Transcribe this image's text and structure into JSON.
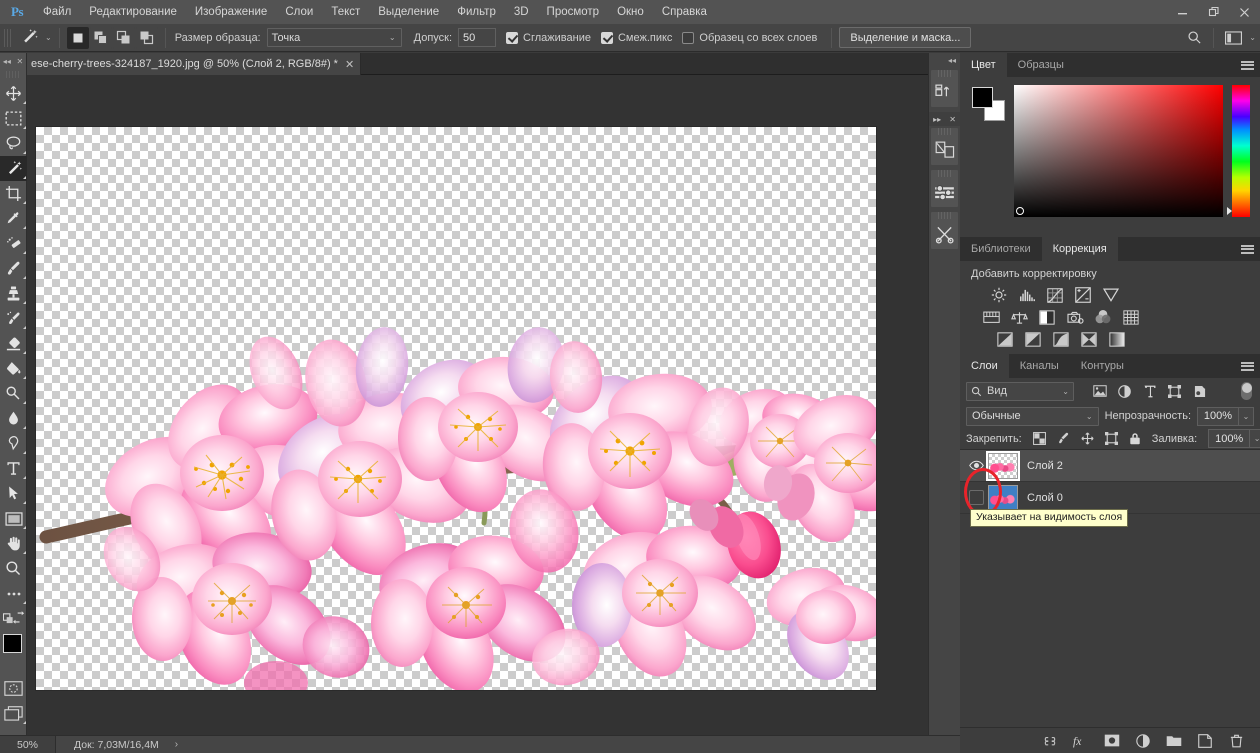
{
  "app": {
    "logo": "Ps",
    "menu": [
      "Файл",
      "Редактирование",
      "Изображение",
      "Слои",
      "Текст",
      "Выделение",
      "Фильтр",
      "3D",
      "Просмотр",
      "Окно",
      "Справка"
    ],
    "window_controls": {
      "minimize": "minimize-icon",
      "restore": "restore-icon",
      "close": "close-icon"
    }
  },
  "options_bar": {
    "tool_icon": "magic-wand-icon",
    "selection_modes": [
      "new-selection",
      "add-to-selection",
      "subtract-from-selection",
      "intersect-selection"
    ],
    "active_selection_mode": 0,
    "sample_size_label": "Размер образца:",
    "sample_size_value": "Точка",
    "tolerance_label": "Допуск:",
    "tolerance_value": "50",
    "antialias_label": "Сглаживание",
    "antialias_checked": true,
    "contiguous_label": "Смеж.пикс",
    "contiguous_checked": true,
    "all_layers_label": "Образец со всех слоев",
    "all_layers_checked": false,
    "select_and_mask_label": "Выделение и маска...",
    "search_icon": "search-icon",
    "workspace_icon": "workspace-switcher-icon"
  },
  "toolbar": {
    "tools": [
      {
        "name": "move-tool",
        "icon": "move-icon",
        "has_flyout": true
      },
      {
        "name": "rectangular-marquee-tool",
        "icon": "marquee-icon",
        "has_flyout": true
      },
      {
        "name": "lasso-tool",
        "icon": "lasso-icon",
        "has_flyout": true
      },
      {
        "name": "magic-wand-tool",
        "icon": "magic-wand-icon",
        "has_flyout": true,
        "active": true
      },
      {
        "name": "crop-tool",
        "icon": "crop-icon",
        "has_flyout": true
      },
      {
        "name": "eyedropper-tool",
        "icon": "eyedropper-icon",
        "has_flyout": true
      },
      {
        "name": "healing-brush-tool",
        "icon": "healing-brush-icon",
        "has_flyout": true
      },
      {
        "name": "brush-tool",
        "icon": "brush-icon",
        "has_flyout": true
      },
      {
        "name": "clone-stamp-tool",
        "icon": "clone-stamp-icon",
        "has_flyout": true
      },
      {
        "name": "history-brush-tool",
        "icon": "history-brush-icon",
        "has_flyout": true
      },
      {
        "name": "eraser-tool",
        "icon": "eraser-icon",
        "has_flyout": true
      },
      {
        "name": "paint-bucket-tool",
        "icon": "paint-bucket-icon",
        "has_flyout": true
      },
      {
        "name": "dodge-tool",
        "icon": "dodge-icon",
        "has_flyout": true
      },
      {
        "name": "blur-tool",
        "icon": "blur-drop-icon",
        "has_flyout": true
      },
      {
        "name": "pen-tool",
        "icon": "pen-icon",
        "has_flyout": true
      },
      {
        "name": "type-tool",
        "icon": "type-icon",
        "has_flyout": true
      },
      {
        "name": "path-selection-tool",
        "icon": "path-arrow-icon",
        "has_flyout": true
      },
      {
        "name": "rectangle-tool",
        "icon": "rectangle-shape-icon",
        "has_flyout": true
      },
      {
        "name": "hand-tool",
        "icon": "hand-icon",
        "has_flyout": true
      },
      {
        "name": "zoom-tool",
        "icon": "zoom-icon",
        "has_flyout": false
      },
      {
        "name": "edit-toolbar",
        "icon": "ellipsis-icon",
        "has_flyout": true
      }
    ],
    "foreground_color": "#000000",
    "background_color": "#ffffff",
    "quick_mask": "quick-mask-icon",
    "screen_mode": "screen-mode-icon"
  },
  "document": {
    "tab_title": "ese-cherry-trees-324187_1920.jpg @ 50% (Слой 2, RGB/8#) *",
    "close_glyph": "✕",
    "zoom": "50%",
    "doc_size": "Док: 7,03M/16,4M",
    "status_arrow": "›"
  },
  "dock_strip": {
    "icons": [
      "workspace-arrange-icon",
      "layer-comps-icon",
      "properties-sliders-icon",
      "tools-scissors-icon"
    ]
  },
  "color_panel": {
    "tabs": [
      {
        "label": "Цвет",
        "active": true
      },
      {
        "label": "Образцы",
        "active": false
      }
    ],
    "menu_icon": "panel-menu-icon",
    "foreground": "#000000",
    "background": "#ffffff",
    "field_base_color": "#fe0000"
  },
  "corrections_panel": {
    "tabs": [
      {
        "label": "Библиотеки",
        "active": false
      },
      {
        "label": "Коррекция",
        "active": true
      }
    ],
    "menu_icon": "panel-menu-icon",
    "title": "Добавить корректировку",
    "row1": [
      "brightness-contrast-icon",
      "levels-icon",
      "curves-icon",
      "exposure-icon",
      "vibrance-icon"
    ],
    "row2": [
      "hue-saturation-icon",
      "color-balance-icon",
      "black-white-icon",
      "photo-filter-icon",
      "channel-mixer-icon",
      "color-lookup-icon"
    ],
    "row3": [
      "invert-icon",
      "posterize-icon",
      "threshold-icon",
      "selective-color-icon",
      "gradient-map-icon"
    ]
  },
  "layers_panel": {
    "tabs": [
      {
        "label": "Слои",
        "active": true
      },
      {
        "label": "Каналы",
        "active": false
      },
      {
        "label": "Контуры",
        "active": false
      }
    ],
    "menu_icon": "panel-menu-icon",
    "filter_kind_value": "Вид",
    "filter_search_icon": "search-icon",
    "filter_icons": [
      "pixel-layers-filter-icon",
      "adjustment-layers-filter-icon",
      "type-layers-filter-icon",
      "shape-layers-filter-icon",
      "smart-object-filter-icon"
    ],
    "filter_toggle": "filter-enable-toggle",
    "blend_mode": "Обычные",
    "opacity_label": "Непрозрачность:",
    "opacity_value": "100%",
    "lock_label": "Закрепить:",
    "lock_icons": [
      "lock-transparent-pixels-icon",
      "lock-image-pixels-icon",
      "lock-position-icon",
      "lock-artboard-icon",
      "lock-all-icon"
    ],
    "fill_label": "Заливка:",
    "fill_value": "100%",
    "layers": [
      {
        "name": "Слой 2",
        "visible": true,
        "selected": true,
        "thumb": "transparent-blossom-thumb"
      },
      {
        "name": "Слой 0",
        "visible": false,
        "selected": false,
        "thumb": "blue-blossom-thumb"
      }
    ],
    "bottom_icons": [
      "link-layers-icon",
      "layer-style-fx-icon",
      "add-layer-mask-icon",
      "new-adjustment-layer-icon",
      "new-group-icon",
      "new-layer-icon",
      "delete-layer-icon"
    ]
  },
  "annotation": {
    "tooltip_text": "Указывает на видимость слоя",
    "highlight_color": "#e8232a",
    "highlight_target": "visibility-toggle-layer-0"
  }
}
